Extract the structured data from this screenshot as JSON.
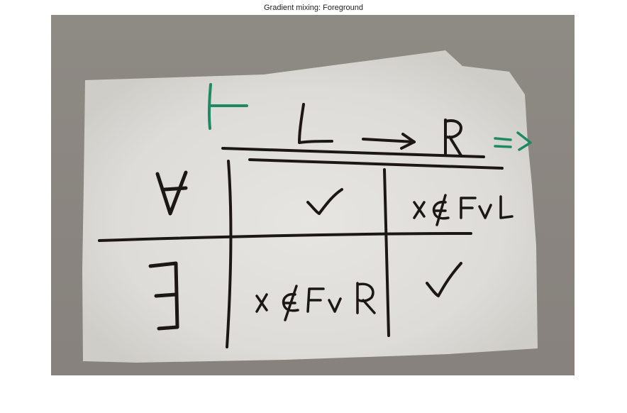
{
  "figure": {
    "title": "Gradient mixing: Foreground"
  },
  "photo": {
    "subject": "handwritten table on paper",
    "colors": {
      "background": "#8b8681",
      "paper": "#e3e2de",
      "ink": "#1c1715",
      "green_ink": "#1e8a63"
    },
    "turnstile_symbol": "⊢",
    "arrow_symbol": "=>",
    "header": {
      "left": "L",
      "right": "R"
    },
    "rows": [
      {
        "quantifier": "∀",
        "left_cell": "✓",
        "right_cell": "x ∉ Fv L"
      },
      {
        "quantifier": "∃",
        "left_cell": "x ∉ Fv R",
        "right_cell": "✓"
      }
    ]
  }
}
